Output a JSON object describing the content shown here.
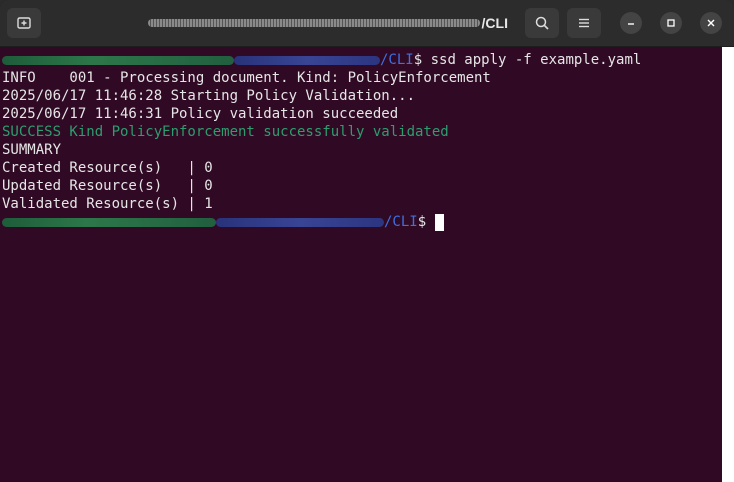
{
  "window": {
    "title": "/CLI"
  },
  "terminal": {
    "prompt_path": "/CLI",
    "prompt_symbol": "$",
    "command": " ssd apply -f example.yaml",
    "lines": {
      "info": "INFO    001 - Processing document. Kind: PolicyEnforcement",
      "start": "2025/06/17 11:46:28 Starting Policy Validation...",
      "validated": "2025/06/17 11:46:31 Policy validation succeeded",
      "success": "SUCCESS Kind PolicyEnforcement successfully validated",
      "summary": "SUMMARY",
      "created": "Created Resource(s)   | 0",
      "updated": "Updated Resource(s)   | 0",
      "validated_count": "Validated Resource(s) | 1"
    }
  },
  "icons": {
    "new_tab": "new-tab-icon",
    "search": "search-icon",
    "menu": "hamburger-menu-icon",
    "minimize": "minimize-icon",
    "maximize": "maximize-icon",
    "close": "close-icon"
  },
  "colors": {
    "background": "#300a24",
    "path": "#3f6fe0",
    "success": "#2e9d6e",
    "text": "#e6e6e6"
  }
}
